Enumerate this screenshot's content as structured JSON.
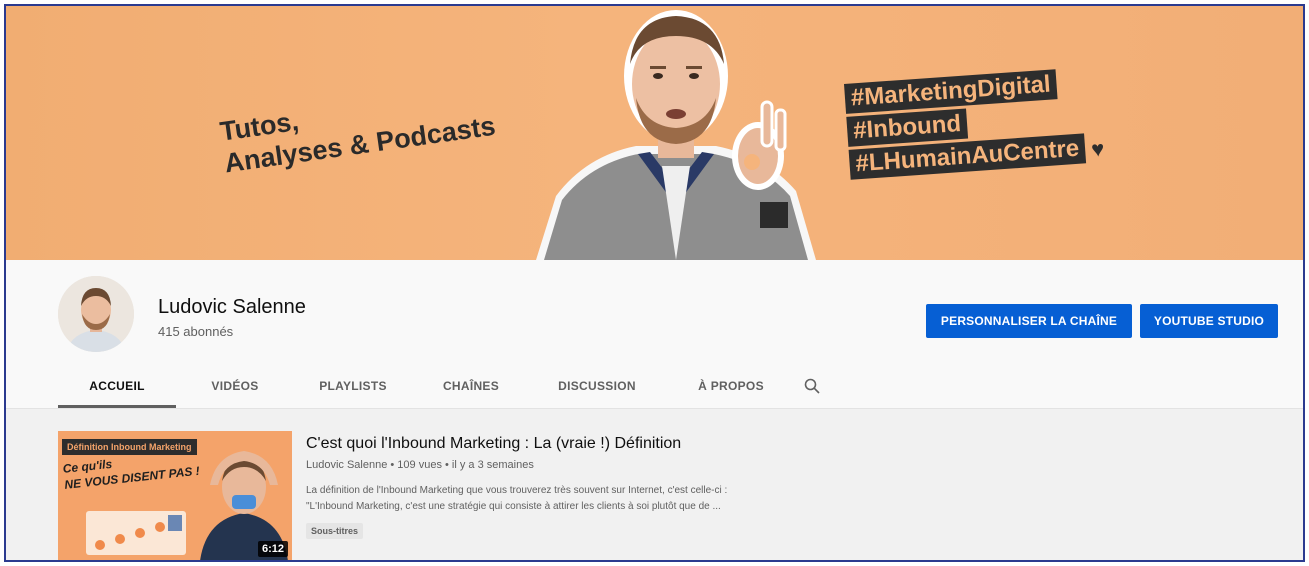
{
  "banner": {
    "left_text_line1": "Tutos,",
    "left_text_line2": "Analyses & Podcasts",
    "hashtags": [
      "#MarketingDigital",
      "#Inbound",
      "#LHumainAuCentre"
    ],
    "heart": "♥"
  },
  "channel": {
    "name": "Ludovic Salenne",
    "subscribers": "415 abonnés"
  },
  "buttons": {
    "customize": "PERSONNALISER LA CHAÎNE",
    "studio": "YOUTUBE STUDIO"
  },
  "tabs": [
    {
      "label": "ACCUEIL"
    },
    {
      "label": "VIDÉOS"
    },
    {
      "label": "PLAYLISTS"
    },
    {
      "label": "CHAÎNES"
    },
    {
      "label": "DISCUSSION"
    },
    {
      "label": "À PROPOS"
    }
  ],
  "featured_video": {
    "thumb_label": "Définition Inbound Marketing",
    "thumb_line1": "Ce qu'ils",
    "thumb_line2": "NE VOUS DISENT PAS !",
    "duration": "6:12",
    "title": "C'est quoi l'Inbound Marketing : La (vraie !) Définition",
    "meta": "Ludovic Salenne • 109 vues • il y a 3 semaines",
    "desc_line1": "La définition de l'Inbound Marketing que vous trouverez très souvent sur Internet, c'est celle-ci :",
    "desc_line2": "\"L'Inbound Marketing, c'est une stratégie qui consiste à attirer les clients à soi plutôt que de ...",
    "badge": "Sous-titres"
  },
  "colors": {
    "banner": "#f5b47c",
    "accent_button": "#065fd4",
    "hashtag_bg": "#2d2d2d"
  }
}
